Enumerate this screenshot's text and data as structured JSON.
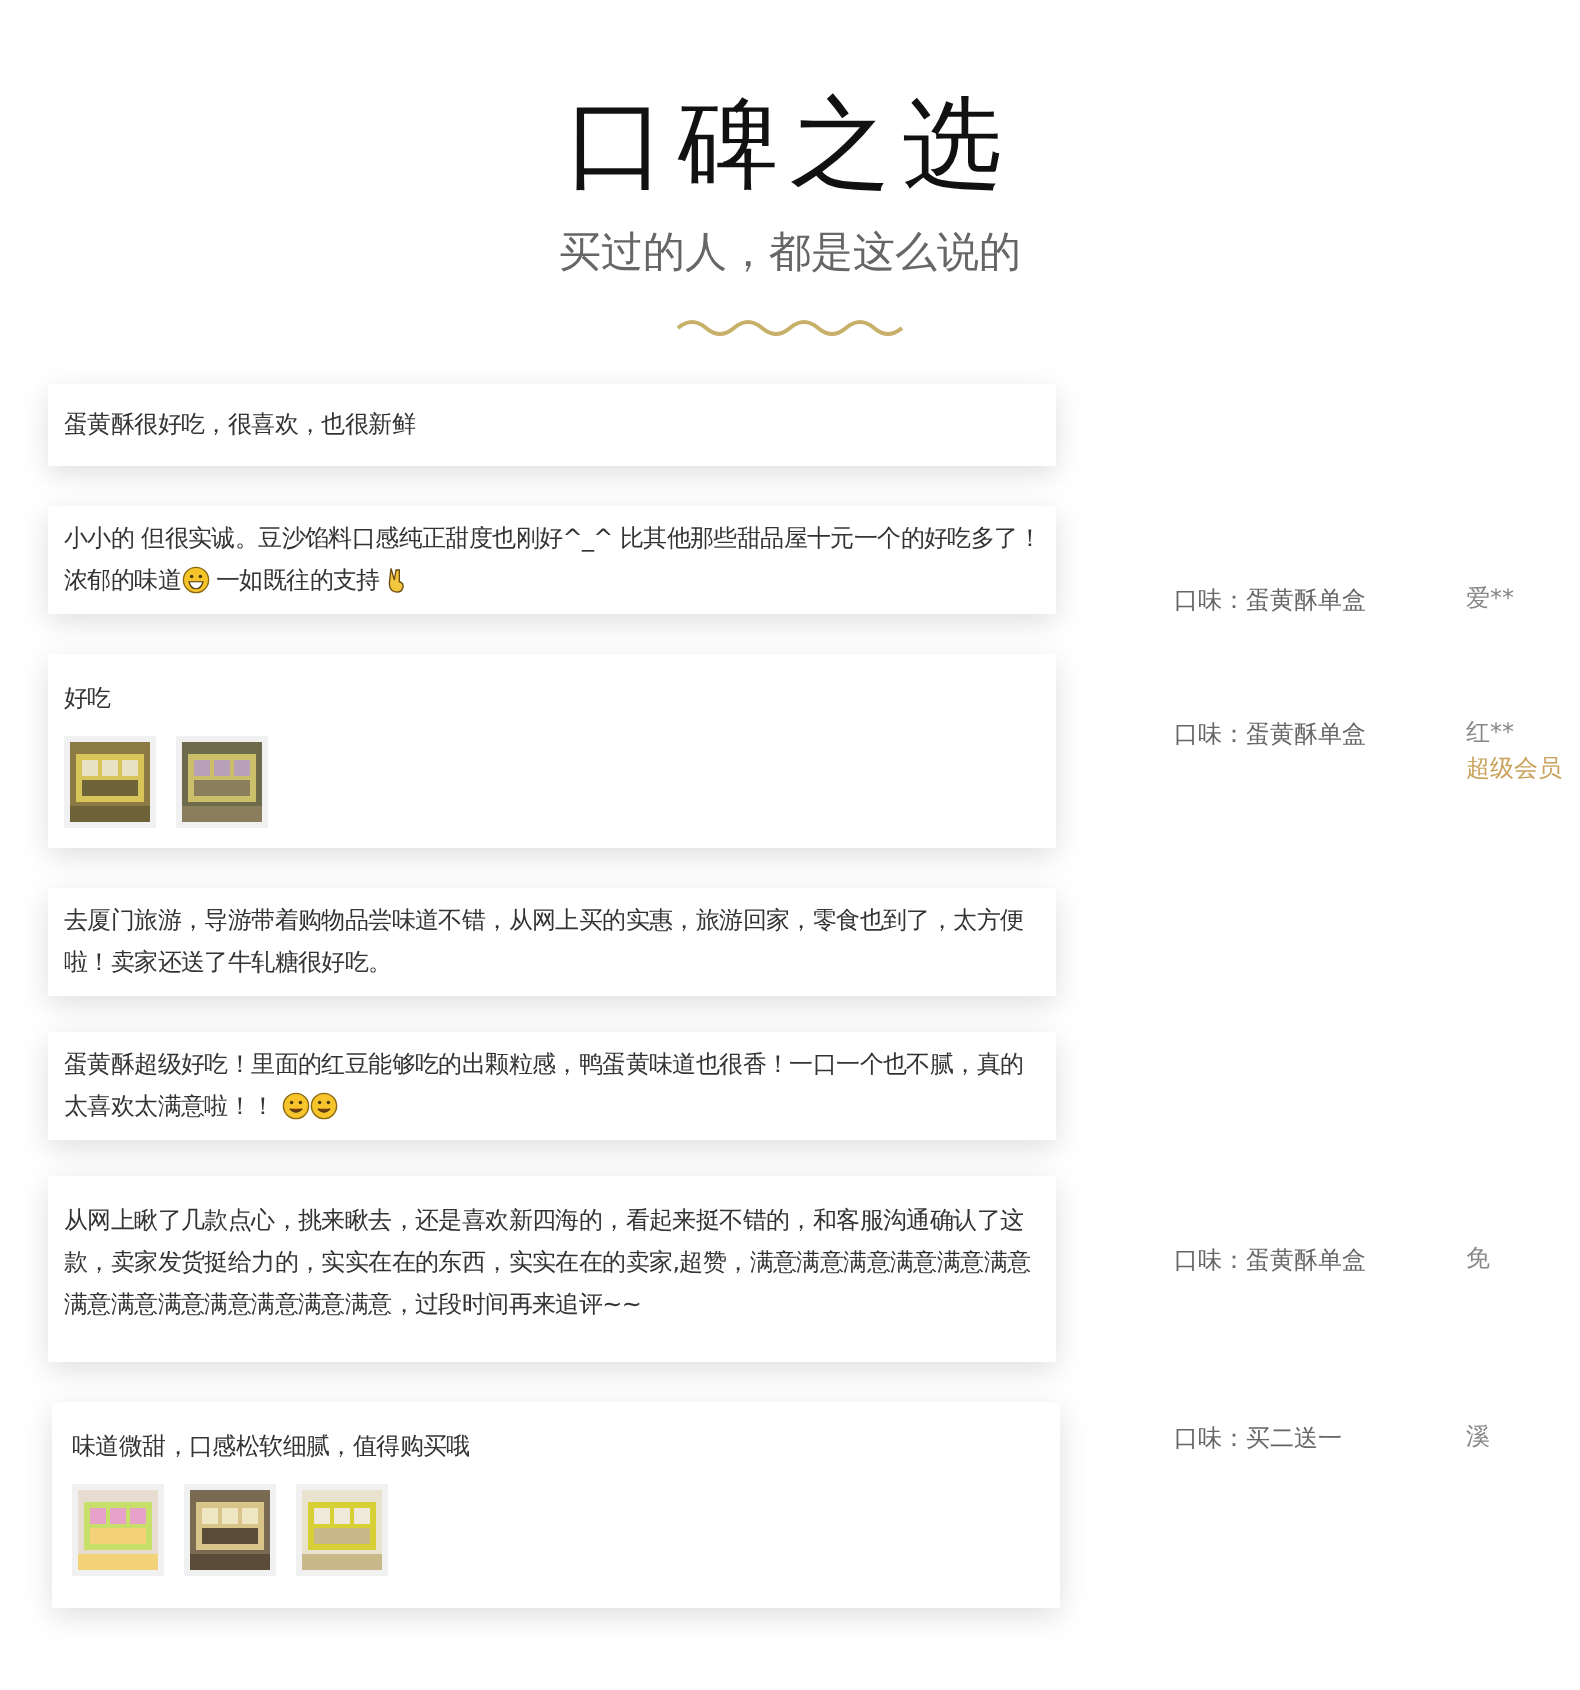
{
  "header": {
    "title": "口碑之选",
    "subtitle": "买过的人，都是这么说的"
  },
  "reviews": [
    {
      "parts": [
        {
          "kind": "text",
          "text": "蛋黄酥很好吃，很喜欢，也很新鲜"
        }
      ]
    },
    {
      "parts": [
        {
          "kind": "text",
          "text": "小小的 但很实诚。豆沙馅料口感纯正甜度也刚好^_^ 比其他那些甜品屋十元一个的好吃多了！浓郁的味道"
        },
        {
          "kind": "grin"
        },
        {
          "kind": "text",
          "text": " 一如既往的支持 "
        },
        {
          "kind": "hand"
        }
      ]
    },
    {
      "parts": [
        {
          "kind": "text",
          "text": "好吃"
        }
      ],
      "photos": [
        {
          "kind": "picture"
        },
        {
          "kind": "picture"
        }
      ]
    },
    {
      "parts": [
        {
          "kind": "text",
          "text": "去厦门旅游，导游带着购物品尝味道不错，从网上买的实惠，旅游回家，零食也到了，太方便啦！卖家还送了牛轧糖很好吃。"
        }
      ]
    },
    {
      "parts": [
        {
          "kind": "text",
          "text": "蛋黄酥超级好吃！里面的红豆能够吃的出颗粒感，鸭蛋黄味道也很香！一口一个也不腻，真的太喜欢太满意啦！！ "
        },
        {
          "kind": "smile"
        },
        {
          "kind": "smile"
        }
      ]
    },
    {
      "parts": [
        {
          "kind": "text",
          "text": "从网上瞅了几款点心，挑来瞅去，还是喜欢新四海的，看起来挺不错的，和客服沟通确认了这款，卖家发货挺给力的，实实在在的东西，实实在在的卖家,超赞，满意满意满意满意满意满意满意满意满意满意满意满意满意，过段时间再来追评~~"
        }
      ]
    },
    {
      "parts": [
        {
          "kind": "text",
          "text": "味道微甜，口感松软细腻，值得购买哦"
        }
      ],
      "photos": [
        {
          "kind": "picture"
        },
        {
          "kind": "picture"
        },
        {
          "kind": "picture"
        }
      ]
    }
  ],
  "side": [
    {
      "flavor": "口味：蛋黄酥单盒",
      "user": "爱**"
    },
    {
      "flavor": "口味：蛋黄酥单盒",
      "user": "红**",
      "badge": "超级会员"
    },
    {
      "flavor": "口味：蛋黄酥单盒",
      "user": "免"
    },
    {
      "flavor": "口味：买二送一",
      "user": "溪"
    }
  ]
}
